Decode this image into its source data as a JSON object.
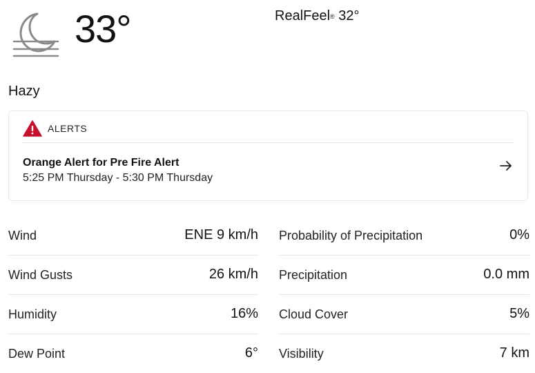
{
  "current": {
    "icon": "hazy-moon-icon",
    "temperature": "33°",
    "realfeel_label": "RealFeel",
    "realfeel_mark": "®",
    "realfeel_value": "32°",
    "condition": "Hazy"
  },
  "alerts": {
    "header": "ALERTS",
    "icon": "warning-triangle-icon",
    "accent_color": "#c8102e",
    "items": [
      {
        "title": "Orange Alert for Pre Fire Alert",
        "time": "5:25 PM Thursday - 5:30 PM Thursday"
      }
    ]
  },
  "details": {
    "left": [
      {
        "label": "Wind",
        "value": "ENE 9 km/h"
      },
      {
        "label": "Wind Gusts",
        "value": "26 km/h"
      },
      {
        "label": "Humidity",
        "value": "16%"
      },
      {
        "label": "Dew Point",
        "value": "6°"
      }
    ],
    "right": [
      {
        "label": "Probability of Precipitation",
        "value": "0%"
      },
      {
        "label": "Precipitation",
        "value": "0.0 mm"
      },
      {
        "label": "Cloud Cover",
        "value": "5%"
      },
      {
        "label": "Visibility",
        "value": "7 km"
      }
    ]
  }
}
